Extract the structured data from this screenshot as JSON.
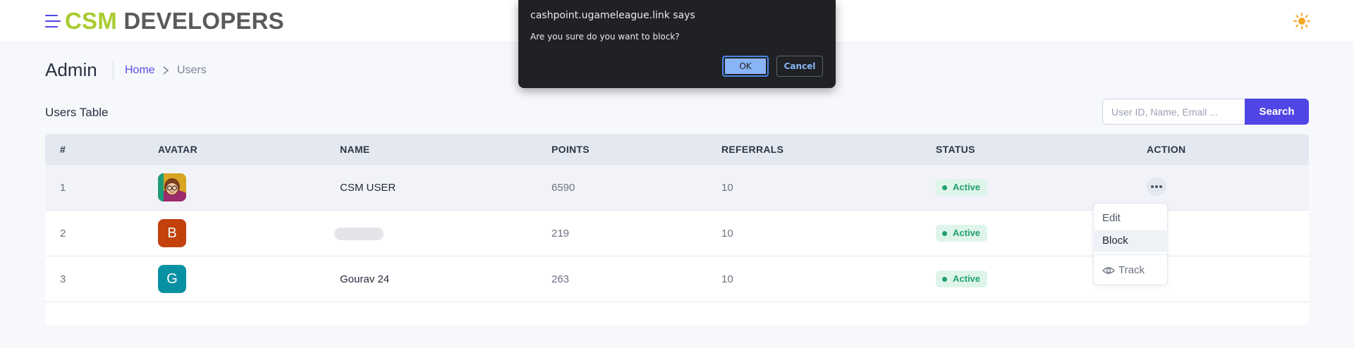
{
  "header": {
    "brand_primary": "CSM",
    "brand_secondary": "DEVELOPERS",
    "menu_icon": "menu-icon",
    "theme_icon": "sun-icon"
  },
  "breadcrumb": {
    "title": "Admin",
    "home": "Home",
    "current": "Users"
  },
  "table": {
    "title": "Users Table",
    "search_placeholder": "User ID, Name, Email ...",
    "search_label": "Search",
    "columns": [
      "#",
      "AVATAR",
      "NAME",
      "POINTS",
      "REFERRALS",
      "STATUS",
      "ACTION"
    ],
    "rows": [
      {
        "index": "1",
        "avatar": "",
        "avatar_color": "#d8a423",
        "name": "CSM USER",
        "points": "6590",
        "referrals": "10",
        "status": "Active"
      },
      {
        "index": "2",
        "avatar": "B",
        "avatar_color": "#c2410c",
        "name": "",
        "points": "219",
        "referrals": "10",
        "status": "Active"
      },
      {
        "index": "3",
        "avatar": "G",
        "avatar_color": "#0891a2",
        "name": "Gourav 24",
        "points": "263",
        "referrals": "10",
        "status": "Active"
      }
    ]
  },
  "action_menu": {
    "edit": "Edit",
    "block": "Block",
    "track": "Track"
  },
  "alert": {
    "title": "cashpoint.ugameleague.link says",
    "message": "Are you sure do you want to block?",
    "ok": "OK",
    "cancel": "Cancel"
  },
  "colors": {
    "brand_green": "#a8cc2f",
    "accent": "#4f46e5",
    "status_active": "#22a06b"
  }
}
